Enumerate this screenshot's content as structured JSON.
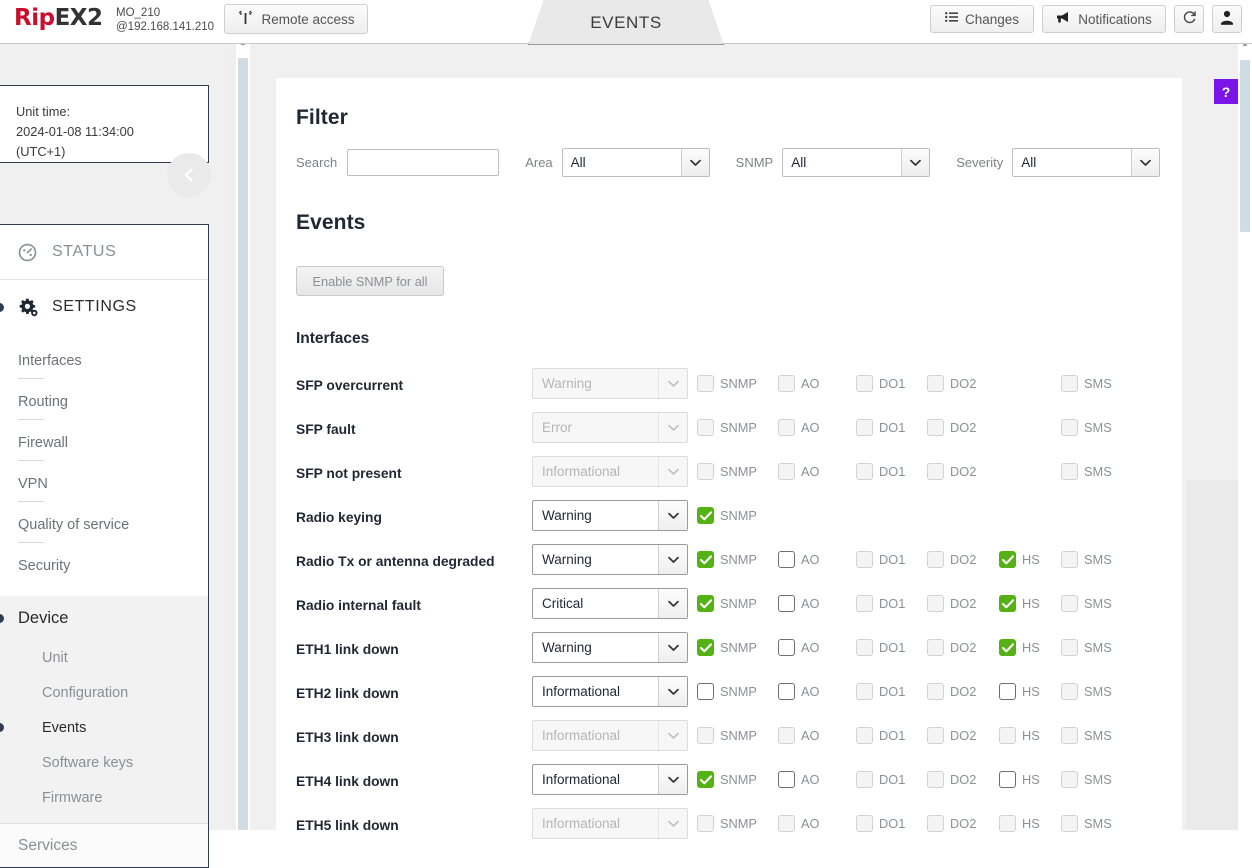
{
  "brand": {
    "logo_rip": "Rip",
    "logo_ex2": "EX2"
  },
  "header": {
    "unit_name": "MO_210",
    "unit_ip": "@192.168.141.210",
    "remote_access_label": "Remote access",
    "changes_label": "Changes",
    "notifications_label": "Notifications",
    "refresh_icon": "refresh-icon",
    "user_icon": "user-icon",
    "antenna_icon": "antenna-icon",
    "list_icon": "list-icon",
    "megaphone_icon": "megaphone-icon",
    "tab_label": "EVENTS"
  },
  "sidebar": {
    "unit_time_label": "Unit time:",
    "unit_time_value": "2024-01-08 11:34:00",
    "unit_time_tz": "(UTC+1)",
    "collapse_icon": "chevron-left-icon",
    "status_label": "STATUS",
    "status_icon": "gauge-icon",
    "settings_label": "SETTINGS",
    "settings_icon": "gears-icon",
    "settings_items": [
      {
        "label": "Interfaces"
      },
      {
        "label": "Routing"
      },
      {
        "label": "Firewall"
      },
      {
        "label": "VPN"
      },
      {
        "label": "Quality of service"
      },
      {
        "label": "Security"
      }
    ],
    "device_label": "Device",
    "device_items": [
      {
        "label": "Unit",
        "active": false
      },
      {
        "label": "Configuration",
        "active": false
      },
      {
        "label": "Events",
        "active": true
      },
      {
        "label": "Software keys",
        "active": false
      },
      {
        "label": "Firmware",
        "active": false
      }
    ],
    "services_label": "Services"
  },
  "filter": {
    "title": "Filter",
    "search_label": "Search",
    "search_value": "",
    "search_placeholder": "",
    "area_label": "Area",
    "area_value": "All",
    "snmp_label": "SNMP",
    "snmp_value": "All",
    "severity_label": "Severity",
    "severity_value": "All",
    "caret_icon": "chevron-down-icon"
  },
  "events": {
    "title": "Events",
    "enable_snmp_label": "Enable SNMP for all",
    "group_title": "Interfaces",
    "columns": [
      "SNMP",
      "AO",
      "DO1",
      "DO2",
      "HS",
      "SMS"
    ],
    "rows": [
      {
        "name": "SFP overcurrent",
        "severity": "Warning",
        "severity_enabled": false,
        "flags": [
          {
            "label": "SNMP",
            "checked": false,
            "enabled": false
          },
          {
            "label": "AO",
            "checked": false,
            "enabled": false
          },
          {
            "label": "DO1",
            "checked": false,
            "enabled": false
          },
          {
            "label": "DO2",
            "checked": false,
            "enabled": false
          },
          {
            "label": "SMS",
            "checked": false,
            "enabled": false
          }
        ]
      },
      {
        "name": "SFP fault",
        "severity": "Error",
        "severity_enabled": false,
        "flags": [
          {
            "label": "SNMP",
            "checked": false,
            "enabled": false
          },
          {
            "label": "AO",
            "checked": false,
            "enabled": false
          },
          {
            "label": "DO1",
            "checked": false,
            "enabled": false
          },
          {
            "label": "DO2",
            "checked": false,
            "enabled": false
          },
          {
            "label": "SMS",
            "checked": false,
            "enabled": false
          }
        ]
      },
      {
        "name": "SFP not present",
        "severity": "Informational",
        "severity_enabled": false,
        "flags": [
          {
            "label": "SNMP",
            "checked": false,
            "enabled": false
          },
          {
            "label": "AO",
            "checked": false,
            "enabled": false
          },
          {
            "label": "DO1",
            "checked": false,
            "enabled": false
          },
          {
            "label": "DO2",
            "checked": false,
            "enabled": false
          },
          {
            "label": "SMS",
            "checked": false,
            "enabled": false
          }
        ]
      },
      {
        "name": "Radio keying",
        "severity": "Warning",
        "severity_enabled": true,
        "flags": [
          {
            "label": "SNMP",
            "checked": true,
            "enabled": true
          }
        ]
      },
      {
        "name": "Radio Tx or antenna degraded",
        "severity": "Warning",
        "severity_enabled": true,
        "flags": [
          {
            "label": "SNMP",
            "checked": true,
            "enabled": true
          },
          {
            "label": "AO",
            "checked": false,
            "enabled": true
          },
          {
            "label": "DO1",
            "checked": false,
            "enabled": false
          },
          {
            "label": "DO2",
            "checked": false,
            "enabled": false
          },
          {
            "label": "HS",
            "checked": true,
            "enabled": true
          },
          {
            "label": "SMS",
            "checked": false,
            "enabled": false
          }
        ]
      },
      {
        "name": "Radio internal fault",
        "severity": "Critical",
        "severity_enabled": true,
        "flags": [
          {
            "label": "SNMP",
            "checked": true,
            "enabled": true
          },
          {
            "label": "AO",
            "checked": false,
            "enabled": true
          },
          {
            "label": "DO1",
            "checked": false,
            "enabled": false
          },
          {
            "label": "DO2",
            "checked": false,
            "enabled": false
          },
          {
            "label": "HS",
            "checked": true,
            "enabled": true
          },
          {
            "label": "SMS",
            "checked": false,
            "enabled": false
          }
        ]
      },
      {
        "name": "ETH1 link down",
        "severity": "Warning",
        "severity_enabled": true,
        "flags": [
          {
            "label": "SNMP",
            "checked": true,
            "enabled": true
          },
          {
            "label": "AO",
            "checked": false,
            "enabled": true
          },
          {
            "label": "DO1",
            "checked": false,
            "enabled": false
          },
          {
            "label": "DO2",
            "checked": false,
            "enabled": false
          },
          {
            "label": "HS",
            "checked": true,
            "enabled": true
          },
          {
            "label": "SMS",
            "checked": false,
            "enabled": false
          }
        ]
      },
      {
        "name": "ETH2 link down",
        "severity": "Informational",
        "severity_enabled": true,
        "flags": [
          {
            "label": "SNMP",
            "checked": false,
            "enabled": true
          },
          {
            "label": "AO",
            "checked": false,
            "enabled": true
          },
          {
            "label": "DO1",
            "checked": false,
            "enabled": false
          },
          {
            "label": "DO2",
            "checked": false,
            "enabled": false
          },
          {
            "label": "HS",
            "checked": false,
            "enabled": true
          },
          {
            "label": "SMS",
            "checked": false,
            "enabled": false
          }
        ]
      },
      {
        "name": "ETH3 link down",
        "severity": "Informational",
        "severity_enabled": false,
        "flags": [
          {
            "label": "SNMP",
            "checked": false,
            "enabled": false
          },
          {
            "label": "AO",
            "checked": false,
            "enabled": false
          },
          {
            "label": "DO1",
            "checked": false,
            "enabled": false
          },
          {
            "label": "DO2",
            "checked": false,
            "enabled": false
          },
          {
            "label": "HS",
            "checked": false,
            "enabled": false
          },
          {
            "label": "SMS",
            "checked": false,
            "enabled": false
          }
        ]
      },
      {
        "name": "ETH4 link down",
        "severity": "Informational",
        "severity_enabled": true,
        "flags": [
          {
            "label": "SNMP",
            "checked": true,
            "enabled": true
          },
          {
            "label": "AO",
            "checked": false,
            "enabled": true
          },
          {
            "label": "DO1",
            "checked": false,
            "enabled": false
          },
          {
            "label": "DO2",
            "checked": false,
            "enabled": false
          },
          {
            "label": "HS",
            "checked": false,
            "enabled": true
          },
          {
            "label": "SMS",
            "checked": false,
            "enabled": false
          }
        ]
      },
      {
        "name": "ETH5 link down",
        "severity": "Informational",
        "severity_enabled": false,
        "flags": [
          {
            "label": "SNMP",
            "checked": false,
            "enabled": false
          },
          {
            "label": "AO",
            "checked": false,
            "enabled": false
          },
          {
            "label": "DO1",
            "checked": false,
            "enabled": false
          },
          {
            "label": "DO2",
            "checked": false,
            "enabled": false
          },
          {
            "label": "HS",
            "checked": false,
            "enabled": false
          },
          {
            "label": "SMS",
            "checked": false,
            "enabled": false
          }
        ]
      }
    ]
  },
  "help": {
    "label": "?",
    "color": "#7b14e8"
  },
  "colors": {
    "brand_red": "#c8102e",
    "checked_green": "#55b216",
    "navy": "#2e3d52"
  }
}
